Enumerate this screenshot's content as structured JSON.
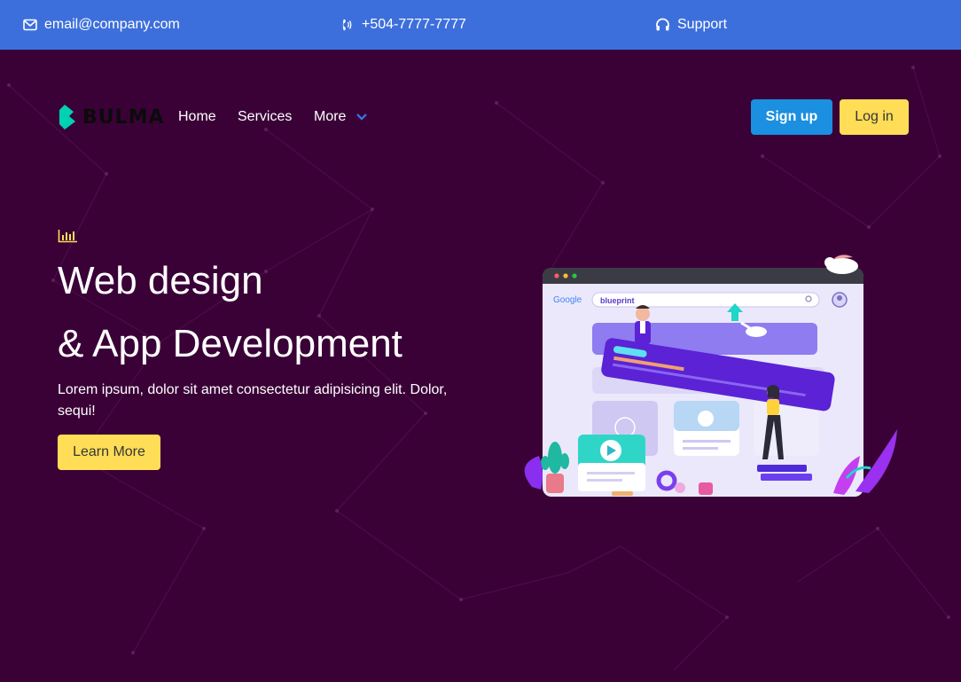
{
  "topbar": {
    "email": "email@company.com",
    "phone": "+504-7777-7777",
    "support": "Support",
    "bg_color": "#3d6fdc"
  },
  "nav": {
    "logo_text": "BULMA",
    "links": [
      "Home",
      "Services",
      "More"
    ],
    "signup_label": "Sign up",
    "login_label": "Log in"
  },
  "hero": {
    "title_line1": "Web design",
    "title_line2": "& App Development",
    "subtitle": "Lorem ipsum, dolor sit amet consectetur adipisicing elit. Dolor, sequi!",
    "cta_label": "Learn More",
    "bg_color": "#3a0137",
    "illustration": {
      "search_text": "blueprint",
      "search_brand": "Google"
    }
  },
  "colors": {
    "primary": "#1b8fe0",
    "warning": "#ffdd57",
    "link": "#3d6fdc",
    "logo_accent": "#00d1b2"
  }
}
